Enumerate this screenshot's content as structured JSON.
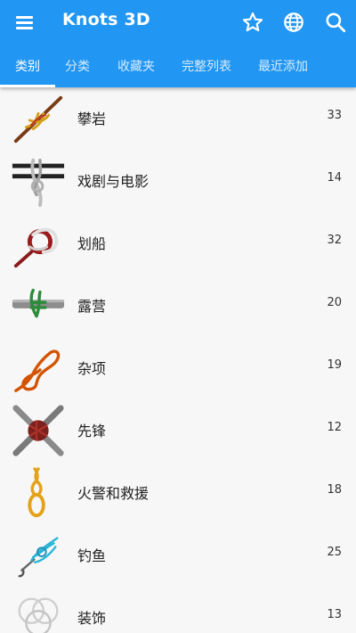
{
  "app": {
    "title": "Knots 3D"
  },
  "toolbar": {
    "menu_icon": "menu-icon",
    "favorite_icon": "star-outline-icon",
    "language_icon": "globe-icon",
    "search_icon": "search-icon",
    "accent": "#2196f3"
  },
  "tabs": [
    {
      "label": "类别",
      "active": true
    },
    {
      "label": "分类",
      "active": false
    },
    {
      "label": "收藏夹",
      "active": false
    },
    {
      "label": "完整列表",
      "active": false
    },
    {
      "label": "最近添加",
      "active": false
    }
  ],
  "categories": [
    {
      "label": "攀岩",
      "count": "33",
      "icon": "climbing-knot-icon"
    },
    {
      "label": "戏剧与电影",
      "count": "14",
      "icon": "theatre-knot-icon"
    },
    {
      "label": "划船",
      "count": "32",
      "icon": "boating-knot-icon"
    },
    {
      "label": "露营",
      "count": "20",
      "icon": "camping-knot-icon"
    },
    {
      "label": "杂项",
      "count": "19",
      "icon": "misc-knot-icon"
    },
    {
      "label": "先锋",
      "count": "12",
      "icon": "pioneering-knot-icon"
    },
    {
      "label": "火警和救援",
      "count": "18",
      "icon": "rescue-knot-icon"
    },
    {
      "label": "钓鱼",
      "count": "25",
      "icon": "fishing-knot-icon"
    },
    {
      "label": "装饰",
      "count": "13",
      "icon": "decorative-knot-icon"
    }
  ]
}
